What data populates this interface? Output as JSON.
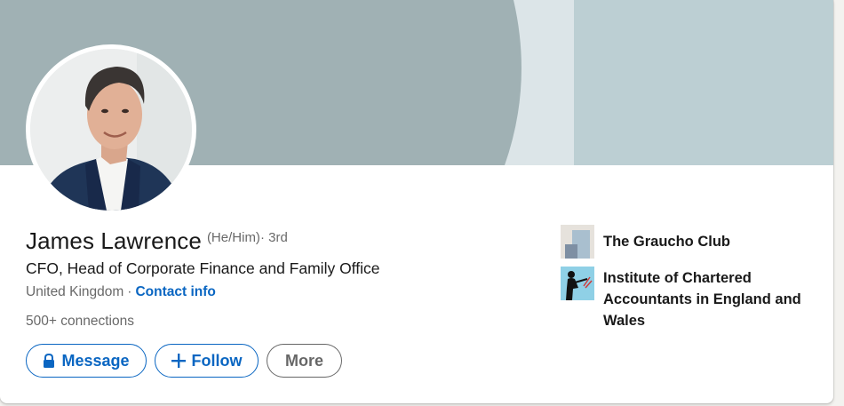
{
  "profile": {
    "name": "James Lawrence",
    "pronouns": "(He/Him)",
    "degree": "· 3rd",
    "headline": "CFO, Head of Corporate Finance and Family Office",
    "location": "United Kingdom",
    "separator": "·",
    "contact_info_label": "Contact info",
    "connections": "500+ connections"
  },
  "actions": {
    "message_label": "Message",
    "follow_label": "Follow",
    "more_label": "More"
  },
  "organizations": [
    {
      "name": "The Graucho Club",
      "logo": "graucho-club-logo"
    },
    {
      "name": "Institute of Chartered Accountants in England and Wales",
      "logo": "icaew-logo"
    }
  ],
  "icons": {
    "message": "lock-icon",
    "follow": "plus-icon"
  },
  "colors": {
    "accent": "#0a66c2",
    "cover_dark": "#a0b1b4",
    "cover_light": "#dce5e8",
    "cover_right": "#bccfd3"
  }
}
